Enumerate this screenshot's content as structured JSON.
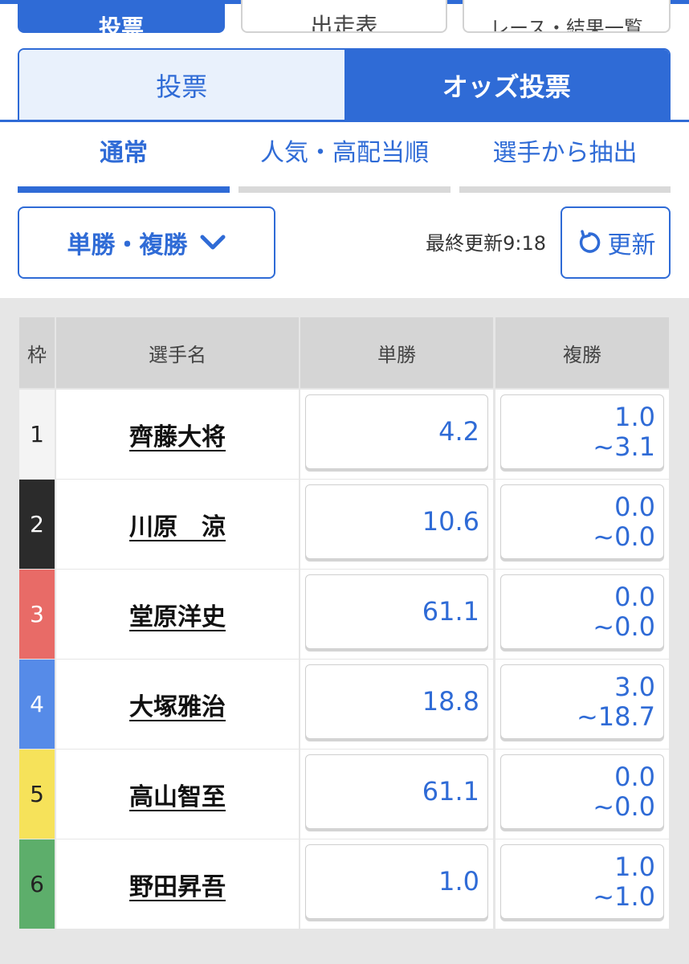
{
  "top_tabs": [
    "投票",
    "出走表",
    "レース・結果一覧"
  ],
  "segments": [
    "投票",
    "オッズ投票"
  ],
  "sub_tabs": [
    "通常",
    "人気・高配当順",
    "選手から抽出"
  ],
  "bet_type": "単勝・複勝",
  "last_updated": "最終更新9:18",
  "refresh_label": "更新",
  "table": {
    "headers": [
      "枠",
      "選手名",
      "単勝",
      "複勝"
    ],
    "rows": [
      {
        "waku": "1",
        "name": "齊藤大将",
        "win": "4.2",
        "place_low": "1.0",
        "place_high": "~3.1"
      },
      {
        "waku": "2",
        "name": "川原　涼",
        "win": "10.6",
        "place_low": "0.0",
        "place_high": "~0.0"
      },
      {
        "waku": "3",
        "name": "堂原洋史",
        "win": "61.1",
        "place_low": "0.0",
        "place_high": "~0.0"
      },
      {
        "waku": "4",
        "name": "大塚雅治",
        "win": "18.8",
        "place_low": "3.0",
        "place_high": "~18.7"
      },
      {
        "waku": "5",
        "name": "高山智至",
        "win": "61.1",
        "place_low": "0.0",
        "place_high": "~0.0"
      },
      {
        "waku": "6",
        "name": "野田昇吾",
        "win": "1.0",
        "place_low": "1.0",
        "place_high": "~1.0"
      }
    ]
  },
  "frame_colors": {
    "1": {
      "bg": "#f4f4f4",
      "fg": "#222222"
    },
    "2": {
      "bg": "#2b2b2b",
      "fg": "#ffffff"
    },
    "3": {
      "bg": "#e86b67",
      "fg": "#ffffff"
    },
    "4": {
      "bg": "#568be8",
      "fg": "#ffffff"
    },
    "5": {
      "bg": "#f6e25a",
      "fg": "#222222"
    },
    "6": {
      "bg": "#5dae6b",
      "fg": "#222222"
    }
  },
  "accent_color": "#2f6bd6"
}
